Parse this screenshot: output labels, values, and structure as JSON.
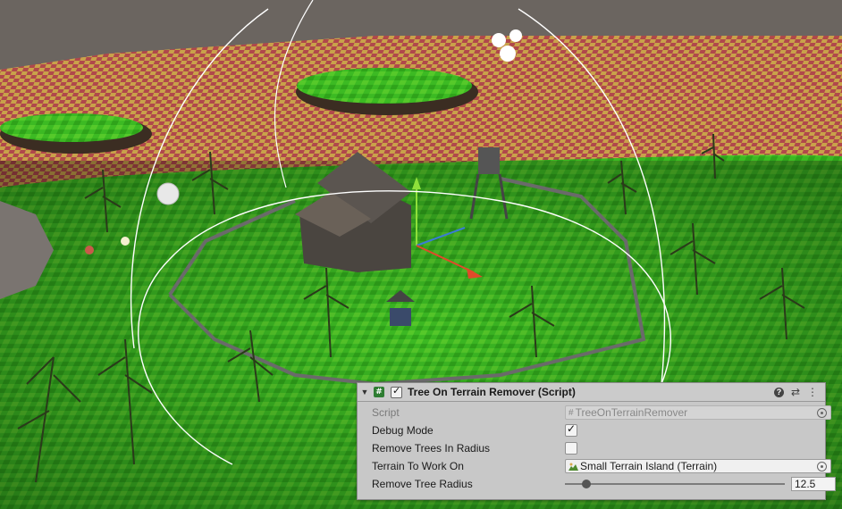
{
  "component": {
    "title": "Tree On Terrain Remover (Script)",
    "enabled": true,
    "icons": [
      "script-icon",
      "help-icon",
      "preset-icon",
      "more-icon"
    ]
  },
  "fields": {
    "script": {
      "label": "Script",
      "value": "TreeOnTerrainRemover"
    },
    "debug_mode": {
      "label": "Debug Mode",
      "checked": true
    },
    "remove_trees_in_radius": {
      "label": "Remove Trees In Radius",
      "checked": false
    },
    "terrain_to_work_on": {
      "label": "Terrain To Work On",
      "value": "Small Terrain Island (Terrain)"
    },
    "remove_tree_radius": {
      "label": "Remove Tree Radius",
      "value": "12.5",
      "slider_fraction": 0.08
    }
  },
  "colors": {
    "terrain_grass": "#39b51f",
    "terrain_checker": "#d6a84a",
    "panel_bg": "#c8c8c8"
  }
}
